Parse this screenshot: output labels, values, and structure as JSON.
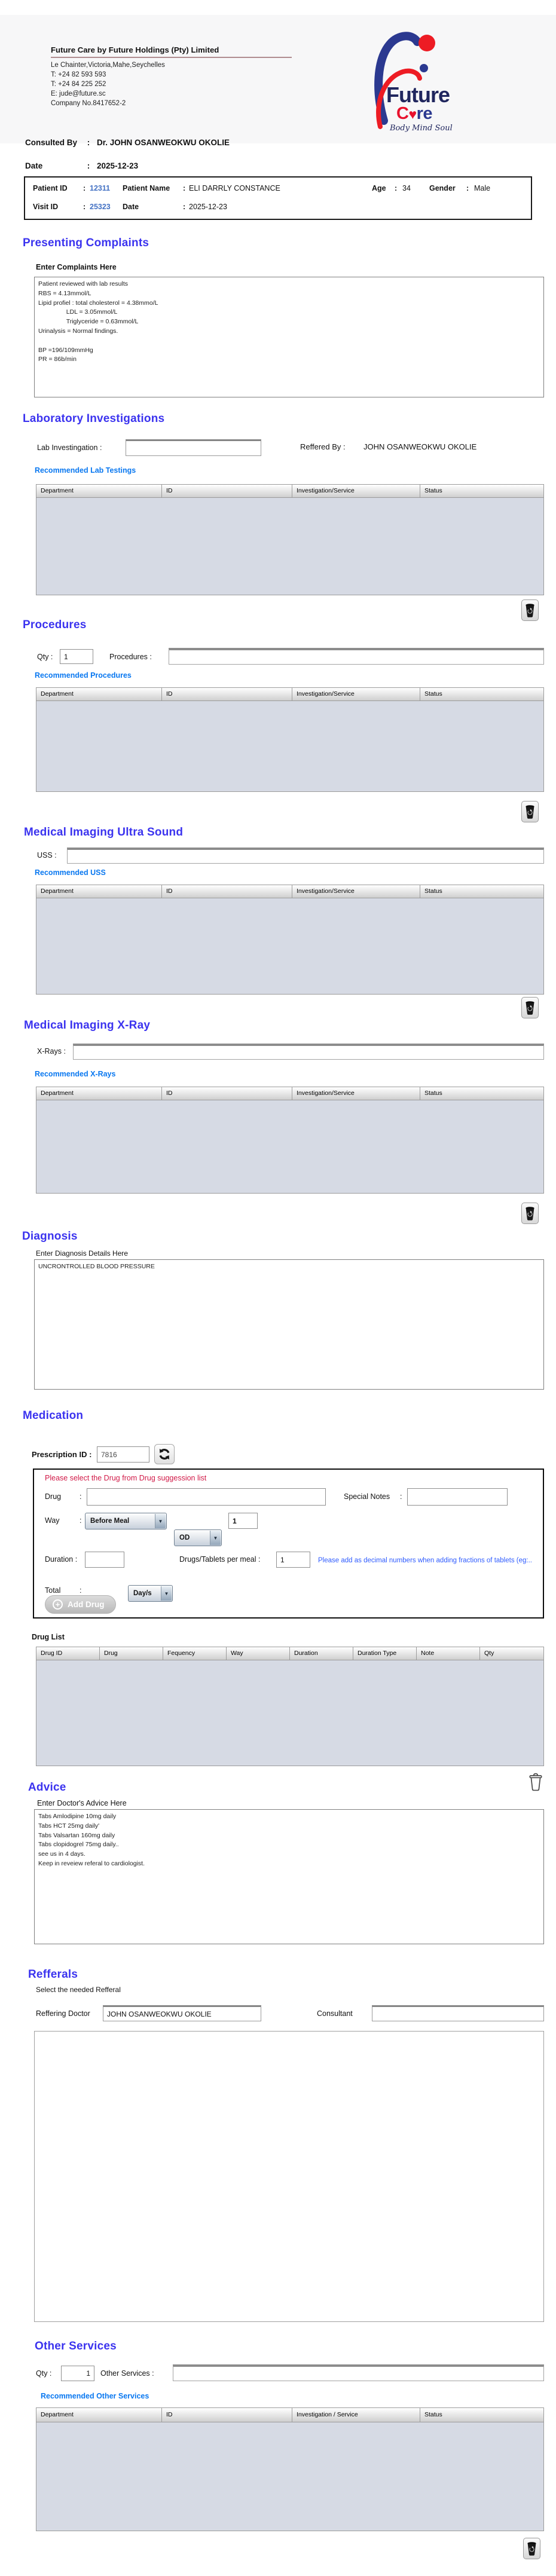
{
  "header": {
    "company_name": "Future Care by Future Holdings (Pty) Limited",
    "address": "Le Chainter,Victoria,Mahe,Seychelles",
    "phone1": "T: +24  82 593 593",
    "phone2": "T: +24  84 225 252",
    "email": "E: jude@future.sc",
    "company_no": "Company No.8417652-2",
    "logo": {
      "word1": "Future",
      "care_c": "C",
      "care_heart": "♥",
      "care_re": "re",
      "tagline": "Body Mind Soul"
    }
  },
  "consulted": {
    "label": "Consulted By",
    "colon": ":",
    "value": "Dr.  JOHN OSANWEOKWU OKOLIE",
    "date_label": "Date",
    "date_colon": ":",
    "date_value": "2025-12-23"
  },
  "patient": {
    "id_label": "Patient ID",
    "id_colon": ":",
    "id_value": "12311",
    "name_label": "Patient Name",
    "name_colon": ":",
    "name_value": "ELI DARRLY CONSTANCE",
    "age_label": "Age",
    "age_colon": ":",
    "age_value": "34",
    "gender_label": "Gender",
    "gender_colon": ":",
    "gender_value": "Male",
    "visit_label": "Visit ID",
    "visit_colon": ":",
    "visit_value": "25323",
    "date_label": "Date",
    "date_colon": ":",
    "date_value": "2025-12-23"
  },
  "complaints": {
    "title": "Presenting Complaints",
    "sublabel": "Enter Complaints Here",
    "text": "Patient reviewed with lab results\nRBS = 4.13mmol/L\nLipid profiel : total cholesterol = 4.38mmo/L\n                LDL = 3.05mmol/L\n                Triglyceride = 0.63mmol/L\nUrinalysis = Normal findings.\n\nBP =196/109mmHg\nPR = 86b/min"
  },
  "rec_headers": [
    "Department",
    "ID",
    "Investigation/Service",
    "Status"
  ],
  "laboratory": {
    "title": "Laboratory  Investigations",
    "lab_label": "Lab Investingation :",
    "referred_label": "Reffered By :",
    "referred_value": "JOHN OSANWEOKWU OKOLIE",
    "link": "Recommended Lab Testings"
  },
  "procedures": {
    "title": "Procedures",
    "qty_label": "Qty :",
    "qty_value": "1",
    "label": "Procedures :",
    "link": "Recommended Procedures"
  },
  "ultrasound": {
    "title": "Medical Imaging Ultra Sound",
    "label": "USS :",
    "link": "Recommended USS"
  },
  "xray": {
    "title": "Medical Imaging X-Ray",
    "label": "X-Rays :",
    "link": "Recommended X-Rays"
  },
  "diagnosis": {
    "title": "Diagnosis",
    "sublabel": "Enter Diagnosis Details Here",
    "text": "UNCRONTROLLED BLOOD PRESSURE"
  },
  "medication": {
    "title": "Medication",
    "prescription_label": "Prescription ID :",
    "prescription_value": "7816",
    "warning": "Please select the Drug from Drug suggession list",
    "drug_label": "Drug",
    "drug_colon": ":",
    "special_label": "Special Notes",
    "special_colon": ":",
    "way_label": "Way",
    "way_colon": ":",
    "way_value": "Before Meal",
    "freq_value": "OD",
    "way_qty": "1",
    "duration_label": "Duration :",
    "duration_unit": "Day/s",
    "per_meal_label": "Drugs/Tablets per meal :",
    "per_meal_value": "1",
    "fraction_note": "Please add as decimal numbers when adding fractions of tablets (eg:..",
    "total_label": "Total",
    "total_colon": ":",
    "add_drug_label": "Add Drug",
    "drug_list_label": "Drug List",
    "drug_headers": [
      "Drug ID",
      "Drug",
      "Fequency",
      "Way",
      "Duration",
      "Duration Type",
      "Note",
      "Qty"
    ]
  },
  "advice": {
    "title": "Advice",
    "sublabel": "Enter Doctor's Advice Here",
    "text": "Tabs Amlodipine 10mg daily\nTabs HCT 25mg daily'\nTabs Valsartan 160mg daily\nTabs clopidogrel 75mg daily..\nsee us in 4 days.\nKeep in reveiew referal to cardiologist."
  },
  "referrals": {
    "title": "Refferals",
    "sublabel": "Select the needed Refferal",
    "doctor_label": "Reffering Doctor",
    "doctor_value": "JOHN OSANWEOKWU OKOLIE",
    "consultant_label": "Consultant"
  },
  "other_services": {
    "title": "Other Services",
    "qty_label": "Qty :",
    "qty_value": "1",
    "label": "Other Services :",
    "link": "Recommended Other Services",
    "headers": [
      "Department",
      "ID",
      "Investigation / Service",
      "Status"
    ]
  }
}
